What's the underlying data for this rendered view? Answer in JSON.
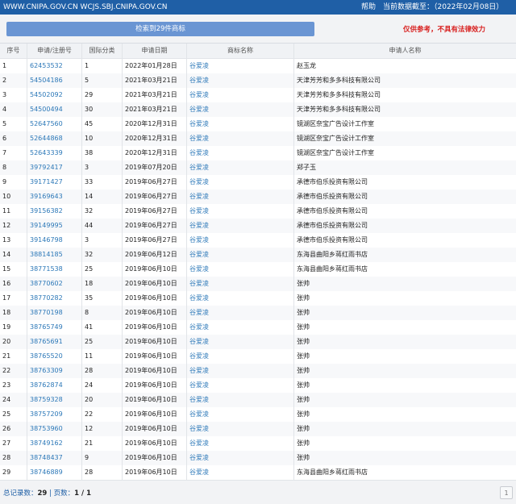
{
  "topbar": {
    "url": "WWW.CNIPA.GOV.CN WCJS.SBJ.CNIPA.GOV.CN",
    "help": "帮助",
    "data_date": "当前数据截至：（2022年02月08日）"
  },
  "search_button": "检索到29件商标",
  "disclaimer": "仅供参考，不具有法律效力",
  "table": {
    "headers": [
      "序号",
      "申请/注册号",
      "国际分类",
      "申请日期",
      "商标名称",
      "申请人名称"
    ],
    "rows": [
      [
        "1",
        "62453532",
        "1",
        "2022年01月28日",
        "谷爱凌",
        "赵玉龙"
      ],
      [
        "2",
        "54504186",
        "5",
        "2021年03月21日",
        "谷爱凌",
        "天津芳芳和多多科技有限公司"
      ],
      [
        "3",
        "54502092",
        "29",
        "2021年03月21日",
        "谷爱凌",
        "天津芳芳和多多科技有限公司"
      ],
      [
        "4",
        "54500494",
        "30",
        "2021年03月21日",
        "谷爱凌",
        "天津芳芳和多多科技有限公司"
      ],
      [
        "5",
        "52647560",
        "45",
        "2020年12月31日",
        "谷爱凌",
        "镜湖区奈宝广告设计工作室"
      ],
      [
        "6",
        "52644868",
        "10",
        "2020年12月31日",
        "谷爱凌",
        "镜湖区奈宝广告设计工作室"
      ],
      [
        "7",
        "52643339",
        "38",
        "2020年12月31日",
        "谷爱凌",
        "镜湖区奈宝广告设计工作室"
      ],
      [
        "8",
        "39792417",
        "3",
        "2019年07月20日",
        "谷爱凌",
        "郑子玉"
      ],
      [
        "9",
        "39171427",
        "33",
        "2019年06月27日",
        "谷爱凌",
        "承德市伯乐投资有限公司"
      ],
      [
        "10",
        "39169643",
        "14",
        "2019年06月27日",
        "谷爱凌",
        "承德市伯乐投资有限公司"
      ],
      [
        "11",
        "39156382",
        "32",
        "2019年06月27日",
        "谷爱凌",
        "承德市伯乐投资有限公司"
      ],
      [
        "12",
        "39149995",
        "44",
        "2019年06月27日",
        "谷爱凌",
        "承德市伯乐投资有限公司"
      ],
      [
        "13",
        "39146798",
        "3",
        "2019年06月27日",
        "谷爱凌",
        "承德市伯乐投资有限公司"
      ],
      [
        "14",
        "38814185",
        "32",
        "2019年06月12日",
        "谷爱凌",
        "东海县曲阳乡蒋红雨书店"
      ],
      [
        "15",
        "38771538",
        "25",
        "2019年06月10日",
        "谷爱凌",
        "东海县曲阳乡蒋红雨书店"
      ],
      [
        "16",
        "38770602",
        "18",
        "2019年06月10日",
        "谷爱凌",
        "张帅"
      ],
      [
        "17",
        "38770282",
        "35",
        "2019年06月10日",
        "谷爱凌",
        "张帅"
      ],
      [
        "18",
        "38770198",
        "8",
        "2019年06月10日",
        "谷爱凌",
        "张帅"
      ],
      [
        "19",
        "38765749",
        "41",
        "2019年06月10日",
        "谷爱凌",
        "张帅"
      ],
      [
        "20",
        "38765691",
        "25",
        "2019年06月10日",
        "谷爱凌",
        "张帅"
      ],
      [
        "21",
        "38765520",
        "11",
        "2019年06月10日",
        "谷爱凌",
        "张帅"
      ],
      [
        "22",
        "38763309",
        "28",
        "2019年06月10日",
        "谷爱凌",
        "张帅"
      ],
      [
        "23",
        "38762874",
        "24",
        "2019年06月10日",
        "谷爱凌",
        "张帅"
      ],
      [
        "24",
        "38759328",
        "20",
        "2019年06月10日",
        "谷爱凌",
        "张帅"
      ],
      [
        "25",
        "38757209",
        "22",
        "2019年06月10日",
        "谷爱凌",
        "张帅"
      ],
      [
        "26",
        "38753960",
        "12",
        "2019年06月10日",
        "谷爱凌",
        "张帅"
      ],
      [
        "27",
        "38749162",
        "21",
        "2019年06月10日",
        "谷爱凌",
        "张帅"
      ],
      [
        "28",
        "38748437",
        "9",
        "2019年06月10日",
        "谷爱凌",
        "张帅"
      ],
      [
        "29",
        "38746889",
        "28",
        "2019年06月10日",
        "谷爱凌",
        "东海县曲阳乡蒋红雨书店"
      ]
    ]
  },
  "footer": {
    "total_label": "总记录数：",
    "total_value": "29",
    "pages_label": " | 页数：",
    "pages_value": "1 / 1",
    "page_button": "1"
  }
}
